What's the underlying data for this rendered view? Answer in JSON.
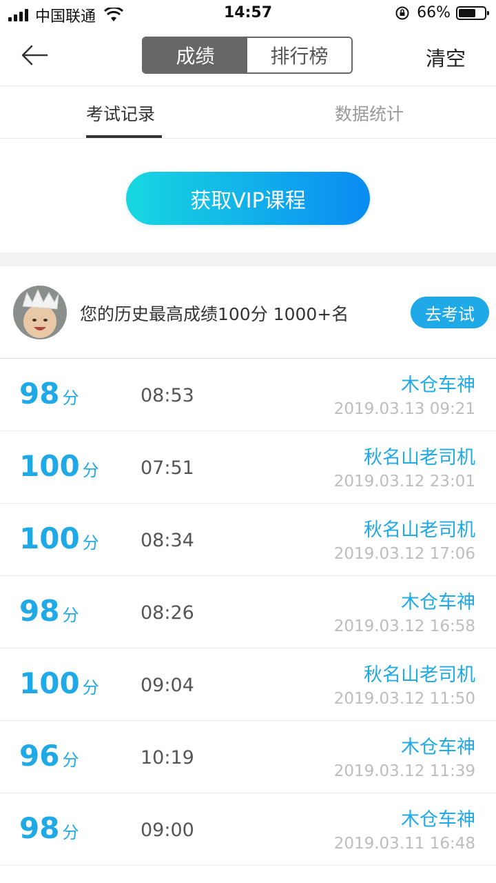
{
  "status_bar": {
    "carrier": "中国联通",
    "time": "14:57",
    "battery": "66%",
    "battery_level": 0.66
  },
  "nav": {
    "back_icon": "arrow-left-icon",
    "seg_scores": "成绩",
    "seg_ranking": "排行榜",
    "clear": "清空"
  },
  "sub_tabs": {
    "records": "考试记录",
    "stats": "数据统计"
  },
  "vip": {
    "label": "获取VIP课程",
    "colors": [
      "#18d8e0",
      "#0a8bf3"
    ]
  },
  "best": {
    "text": "您的历史最高成绩100分 1000+名",
    "exam_button": "去考试"
  },
  "score_unit": "分",
  "accent_color": "#1fa9e6",
  "records": [
    {
      "score": "98",
      "duration": "08:53",
      "name": "木仓车神",
      "time": "2019.03.13 09:21"
    },
    {
      "score": "100",
      "duration": "07:51",
      "name": "秋名山老司机",
      "time": "2019.03.12 23:01"
    },
    {
      "score": "100",
      "duration": "08:34",
      "name": "秋名山老司机",
      "time": "2019.03.12 17:06"
    },
    {
      "score": "98",
      "duration": "08:26",
      "name": "木仓车神",
      "time": "2019.03.12 16:58"
    },
    {
      "score": "100",
      "duration": "09:04",
      "name": "秋名山老司机",
      "time": "2019.03.12 11:50"
    },
    {
      "score": "96",
      "duration": "10:19",
      "name": "木仓车神",
      "time": "2019.03.12 11:39"
    },
    {
      "score": "98",
      "duration": "09:00",
      "name": "木仓车神",
      "time": "2019.03.11 16:48"
    }
  ]
}
